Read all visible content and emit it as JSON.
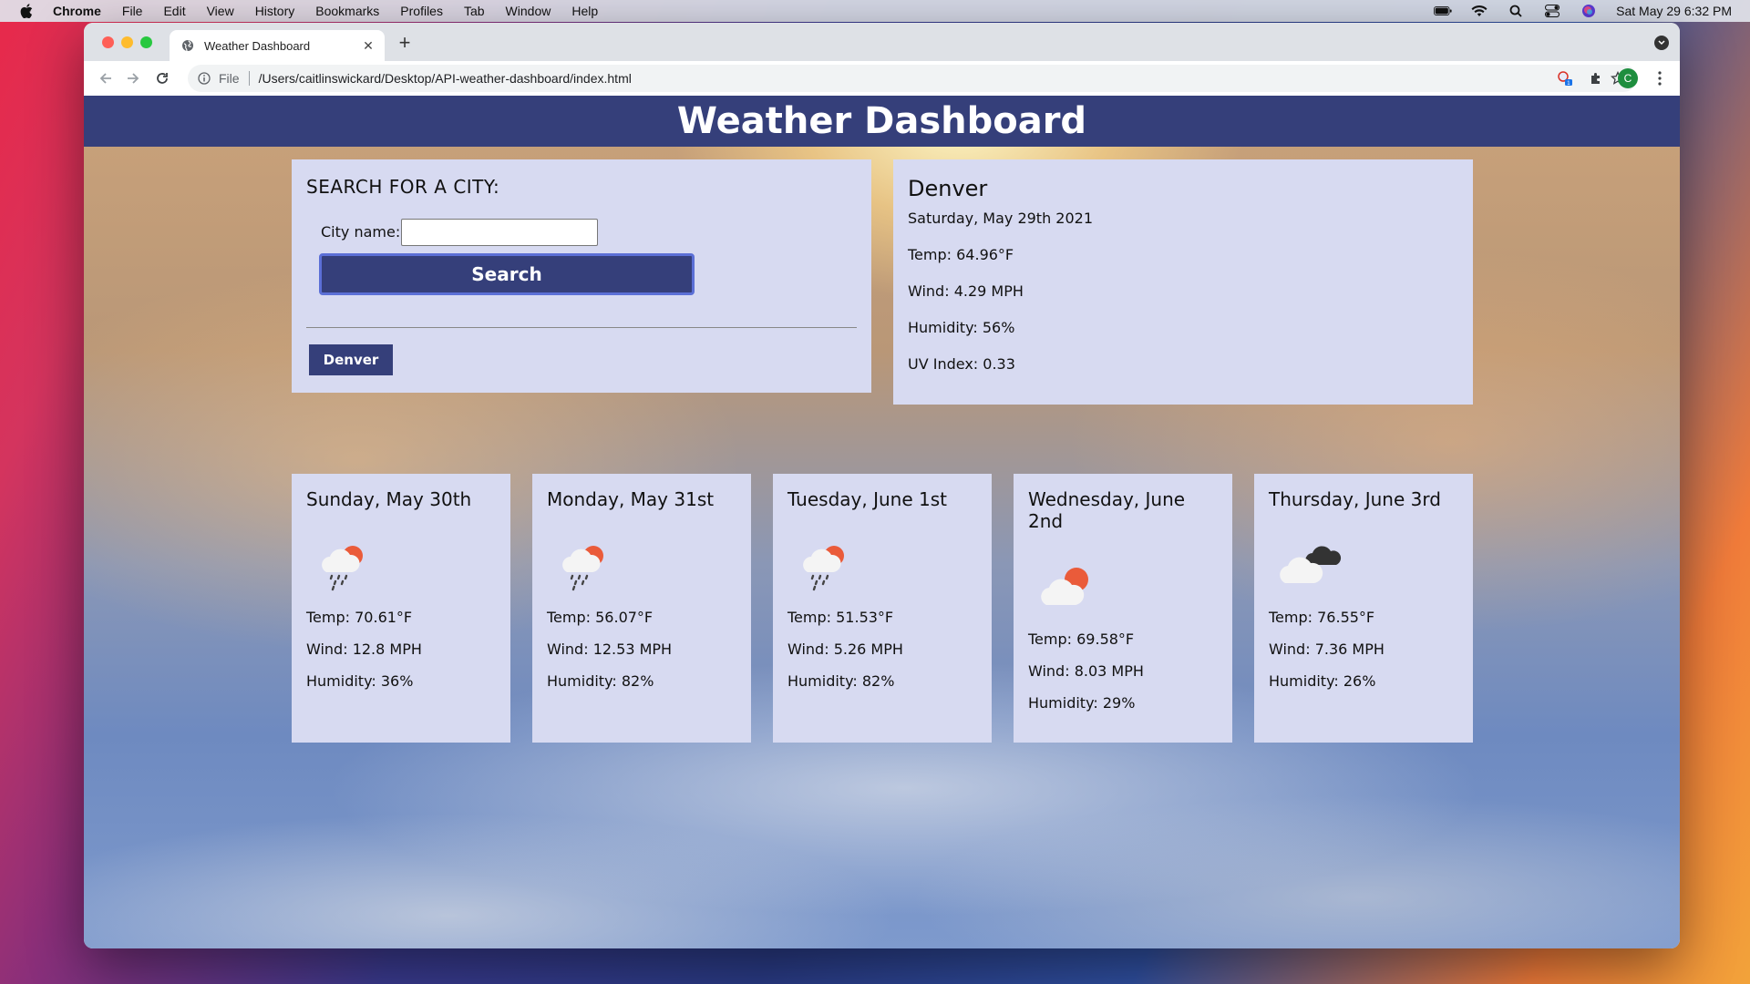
{
  "menubar": {
    "app": "Chrome",
    "items": [
      "File",
      "Edit",
      "View",
      "History",
      "Bookmarks",
      "Profiles",
      "Tab",
      "Window",
      "Help"
    ],
    "datetime": "Sat May 29  6:32 PM"
  },
  "browser": {
    "tab_title": "Weather Dashboard",
    "scheme_label": "File",
    "url": "/Users/caitlinswickard/Desktop/API-weather-dashboard/index.html",
    "profile_initial": "C"
  },
  "page": {
    "header": "Weather Dashboard",
    "search": {
      "title": "SEARCH FOR A CITY:",
      "city_label": "City name:",
      "city_value": "",
      "button": "Search",
      "history": [
        "Denver"
      ]
    },
    "current": {
      "city": "Denver",
      "date": "Saturday, May 29th 2021",
      "temp": "Temp: 64.96°F",
      "wind": "Wind: 4.29 MPH",
      "humidity": "Humidity: 56%",
      "uv": "UV Index: 0.33"
    },
    "forecast": [
      {
        "date": "Sunday, May 30th",
        "icon": "rain-sun-icon",
        "temp": "Temp: 70.61°F",
        "wind": "Wind: 12.8 MPH",
        "humidity": "Humidity: 36%"
      },
      {
        "date": "Monday, May 31st",
        "icon": "rain-sun-icon",
        "temp": "Temp: 56.07°F",
        "wind": "Wind: 12.53 MPH",
        "humidity": "Humidity: 82%"
      },
      {
        "date": "Tuesday, June 1st",
        "icon": "rain-sun-icon",
        "temp": "Temp: 51.53°F",
        "wind": "Wind: 5.26 MPH",
        "humidity": "Humidity: 82%"
      },
      {
        "date": "Wednesday, June 2nd",
        "icon": "partly-cloudy-icon",
        "temp": "Temp: 69.58°F",
        "wind": "Wind: 8.03 MPH",
        "humidity": "Humidity: 29%"
      },
      {
        "date": "Thursday, June 3rd",
        "icon": "broken-clouds-icon",
        "temp": "Temp: 76.55°F",
        "wind": "Wind: 7.36 MPH",
        "humidity": "Humidity: 26%"
      }
    ]
  },
  "colors": {
    "header_bg": "#353f7a",
    "panel_bg": "#d7daf1",
    "button_border": "#5b6fd6",
    "sun": "#ea5b3a"
  }
}
